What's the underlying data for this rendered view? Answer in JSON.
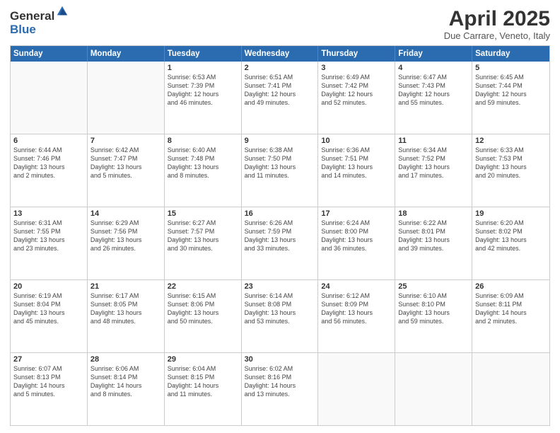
{
  "logo": {
    "general": "General",
    "blue": "Blue"
  },
  "title": "April 2025",
  "location": "Due Carrare, Veneto, Italy",
  "header_days": [
    "Sunday",
    "Monday",
    "Tuesday",
    "Wednesday",
    "Thursday",
    "Friday",
    "Saturday"
  ],
  "weeks": [
    [
      {
        "day": "",
        "lines": []
      },
      {
        "day": "",
        "lines": []
      },
      {
        "day": "1",
        "lines": [
          "Sunrise: 6:53 AM",
          "Sunset: 7:39 PM",
          "Daylight: 12 hours",
          "and 46 minutes."
        ]
      },
      {
        "day": "2",
        "lines": [
          "Sunrise: 6:51 AM",
          "Sunset: 7:41 PM",
          "Daylight: 12 hours",
          "and 49 minutes."
        ]
      },
      {
        "day": "3",
        "lines": [
          "Sunrise: 6:49 AM",
          "Sunset: 7:42 PM",
          "Daylight: 12 hours",
          "and 52 minutes."
        ]
      },
      {
        "day": "4",
        "lines": [
          "Sunrise: 6:47 AM",
          "Sunset: 7:43 PM",
          "Daylight: 12 hours",
          "and 55 minutes."
        ]
      },
      {
        "day": "5",
        "lines": [
          "Sunrise: 6:45 AM",
          "Sunset: 7:44 PM",
          "Daylight: 12 hours",
          "and 59 minutes."
        ]
      }
    ],
    [
      {
        "day": "6",
        "lines": [
          "Sunrise: 6:44 AM",
          "Sunset: 7:46 PM",
          "Daylight: 13 hours",
          "and 2 minutes."
        ]
      },
      {
        "day": "7",
        "lines": [
          "Sunrise: 6:42 AM",
          "Sunset: 7:47 PM",
          "Daylight: 13 hours",
          "and 5 minutes."
        ]
      },
      {
        "day": "8",
        "lines": [
          "Sunrise: 6:40 AM",
          "Sunset: 7:48 PM",
          "Daylight: 13 hours",
          "and 8 minutes."
        ]
      },
      {
        "day": "9",
        "lines": [
          "Sunrise: 6:38 AM",
          "Sunset: 7:50 PM",
          "Daylight: 13 hours",
          "and 11 minutes."
        ]
      },
      {
        "day": "10",
        "lines": [
          "Sunrise: 6:36 AM",
          "Sunset: 7:51 PM",
          "Daylight: 13 hours",
          "and 14 minutes."
        ]
      },
      {
        "day": "11",
        "lines": [
          "Sunrise: 6:34 AM",
          "Sunset: 7:52 PM",
          "Daylight: 13 hours",
          "and 17 minutes."
        ]
      },
      {
        "day": "12",
        "lines": [
          "Sunrise: 6:33 AM",
          "Sunset: 7:53 PM",
          "Daylight: 13 hours",
          "and 20 minutes."
        ]
      }
    ],
    [
      {
        "day": "13",
        "lines": [
          "Sunrise: 6:31 AM",
          "Sunset: 7:55 PM",
          "Daylight: 13 hours",
          "and 23 minutes."
        ]
      },
      {
        "day": "14",
        "lines": [
          "Sunrise: 6:29 AM",
          "Sunset: 7:56 PM",
          "Daylight: 13 hours",
          "and 26 minutes."
        ]
      },
      {
        "day": "15",
        "lines": [
          "Sunrise: 6:27 AM",
          "Sunset: 7:57 PM",
          "Daylight: 13 hours",
          "and 30 minutes."
        ]
      },
      {
        "day": "16",
        "lines": [
          "Sunrise: 6:26 AM",
          "Sunset: 7:59 PM",
          "Daylight: 13 hours",
          "and 33 minutes."
        ]
      },
      {
        "day": "17",
        "lines": [
          "Sunrise: 6:24 AM",
          "Sunset: 8:00 PM",
          "Daylight: 13 hours",
          "and 36 minutes."
        ]
      },
      {
        "day": "18",
        "lines": [
          "Sunrise: 6:22 AM",
          "Sunset: 8:01 PM",
          "Daylight: 13 hours",
          "and 39 minutes."
        ]
      },
      {
        "day": "19",
        "lines": [
          "Sunrise: 6:20 AM",
          "Sunset: 8:02 PM",
          "Daylight: 13 hours",
          "and 42 minutes."
        ]
      }
    ],
    [
      {
        "day": "20",
        "lines": [
          "Sunrise: 6:19 AM",
          "Sunset: 8:04 PM",
          "Daylight: 13 hours",
          "and 45 minutes."
        ]
      },
      {
        "day": "21",
        "lines": [
          "Sunrise: 6:17 AM",
          "Sunset: 8:05 PM",
          "Daylight: 13 hours",
          "and 48 minutes."
        ]
      },
      {
        "day": "22",
        "lines": [
          "Sunrise: 6:15 AM",
          "Sunset: 8:06 PM",
          "Daylight: 13 hours",
          "and 50 minutes."
        ]
      },
      {
        "day": "23",
        "lines": [
          "Sunrise: 6:14 AM",
          "Sunset: 8:08 PM",
          "Daylight: 13 hours",
          "and 53 minutes."
        ]
      },
      {
        "day": "24",
        "lines": [
          "Sunrise: 6:12 AM",
          "Sunset: 8:09 PM",
          "Daylight: 13 hours",
          "and 56 minutes."
        ]
      },
      {
        "day": "25",
        "lines": [
          "Sunrise: 6:10 AM",
          "Sunset: 8:10 PM",
          "Daylight: 13 hours",
          "and 59 minutes."
        ]
      },
      {
        "day": "26",
        "lines": [
          "Sunrise: 6:09 AM",
          "Sunset: 8:11 PM",
          "Daylight: 14 hours",
          "and 2 minutes."
        ]
      }
    ],
    [
      {
        "day": "27",
        "lines": [
          "Sunrise: 6:07 AM",
          "Sunset: 8:13 PM",
          "Daylight: 14 hours",
          "and 5 minutes."
        ]
      },
      {
        "day": "28",
        "lines": [
          "Sunrise: 6:06 AM",
          "Sunset: 8:14 PM",
          "Daylight: 14 hours",
          "and 8 minutes."
        ]
      },
      {
        "day": "29",
        "lines": [
          "Sunrise: 6:04 AM",
          "Sunset: 8:15 PM",
          "Daylight: 14 hours",
          "and 11 minutes."
        ]
      },
      {
        "day": "30",
        "lines": [
          "Sunrise: 6:02 AM",
          "Sunset: 8:16 PM",
          "Daylight: 14 hours",
          "and 13 minutes."
        ]
      },
      {
        "day": "",
        "lines": []
      },
      {
        "day": "",
        "lines": []
      },
      {
        "day": "",
        "lines": []
      }
    ]
  ]
}
